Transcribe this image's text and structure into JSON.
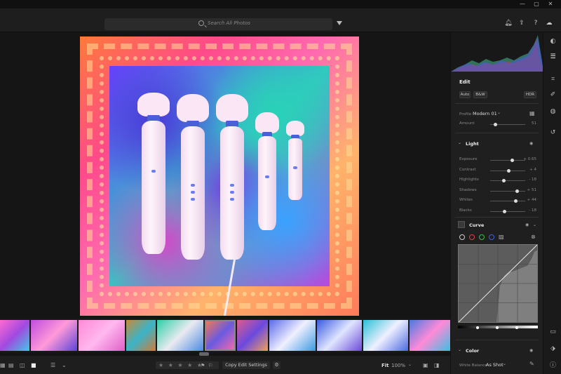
{
  "window": {
    "minimize": "—",
    "maximize": "▢",
    "close": "✕"
  },
  "search": {
    "placeholder": "Search All Photos"
  },
  "header_icons": [
    "bell-icon",
    "share-icon",
    "help-icon",
    "cloud-icon"
  ],
  "right_rail_icons": [
    "edit-icon",
    "sliders-icon",
    "crop-icon",
    "heal-icon",
    "mask-icon",
    "history-icon",
    "comment-icon",
    "tag-icon",
    "info-icon"
  ],
  "panel": {
    "edit_title": "Edit",
    "auto": "Auto",
    "bw": "B&W",
    "hdr": "HDR",
    "profile_label": "Profile",
    "profile_value": "Modern 01",
    "amount_label": "Amount",
    "amount_value": "51",
    "light_title": "Light",
    "light_sliders": [
      {
        "label": "Exposure",
        "value": "+ 0.65",
        "pos": 0.62
      },
      {
        "label": "Contrast",
        "value": "+ 4",
        "pos": 0.52
      },
      {
        "label": "Highlights",
        "value": "- 18",
        "pos": 0.38
      },
      {
        "label": "Shadows",
        "value": "+ 51",
        "pos": 0.76
      },
      {
        "label": "Whites",
        "value": "+ 44",
        "pos": 0.72
      },
      {
        "label": "Blacks",
        "value": "- 18",
        "pos": 0.4
      }
    ],
    "curve_title": "Curve",
    "color_title": "Color",
    "wb_label": "White Balance",
    "wb_value": "As Shot"
  },
  "bottom": {
    "stars": "★ ★ ★ ★ ★",
    "copy_edit": "Copy Edit Settings",
    "fit": "Fit",
    "zoom": "100%"
  }
}
